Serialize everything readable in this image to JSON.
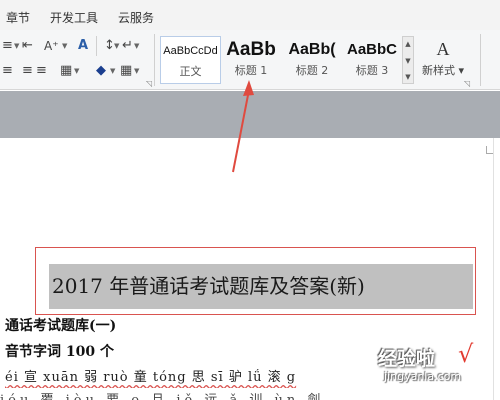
{
  "tabs": [
    "章节",
    "开发工具",
    "云服务"
  ],
  "ribbon": {
    "row1": {
      "list_icon": "≡",
      "font_grow_icon": "A⁺",
      "clear_format_icon": "A",
      "sort_icon": "↕",
      "align_icon": "≡",
      "show_marks_icon": "↵",
      "border_icon": "⊞"
    },
    "row2": {
      "align_left_icon": "≡",
      "center_icon": "≡",
      "align_right_icon": "≡",
      "justify_icon": "▦",
      "shading_icon": "◆",
      "borders_icon": "▦"
    },
    "styles": [
      {
        "sample": "AaBbCcDd",
        "name": "正文"
      },
      {
        "sample": "AaBb",
        "name": "标题 1"
      },
      {
        "sample": "AaBb(",
        "name": "标题 2"
      },
      {
        "sample": "AaBbC",
        "name": "标题 3"
      }
    ],
    "new_style": {
      "icon": "A",
      "label": "新样式"
    }
  },
  "document": {
    "title": "2017 年普通话考试题库及答案(新)",
    "line1": "通话考试题库(一)",
    "line2": "音节字词 100 个",
    "line3": "éi 宣 xuān 弱 ruò 童 tóng 思 sī 驴 lǘ 滚 g",
    "line4": "ióu 覆 iòu 要 o 且 iě 远 ǎ 训 ùn 劍"
  },
  "watermark": {
    "text": "经验啦",
    "check": "√",
    "url": "jingyanla.com"
  },
  "colors": {
    "highlight_border": "#d9534f",
    "arrow": "#e04a3f",
    "title_shading": "#c0c0c0"
  }
}
